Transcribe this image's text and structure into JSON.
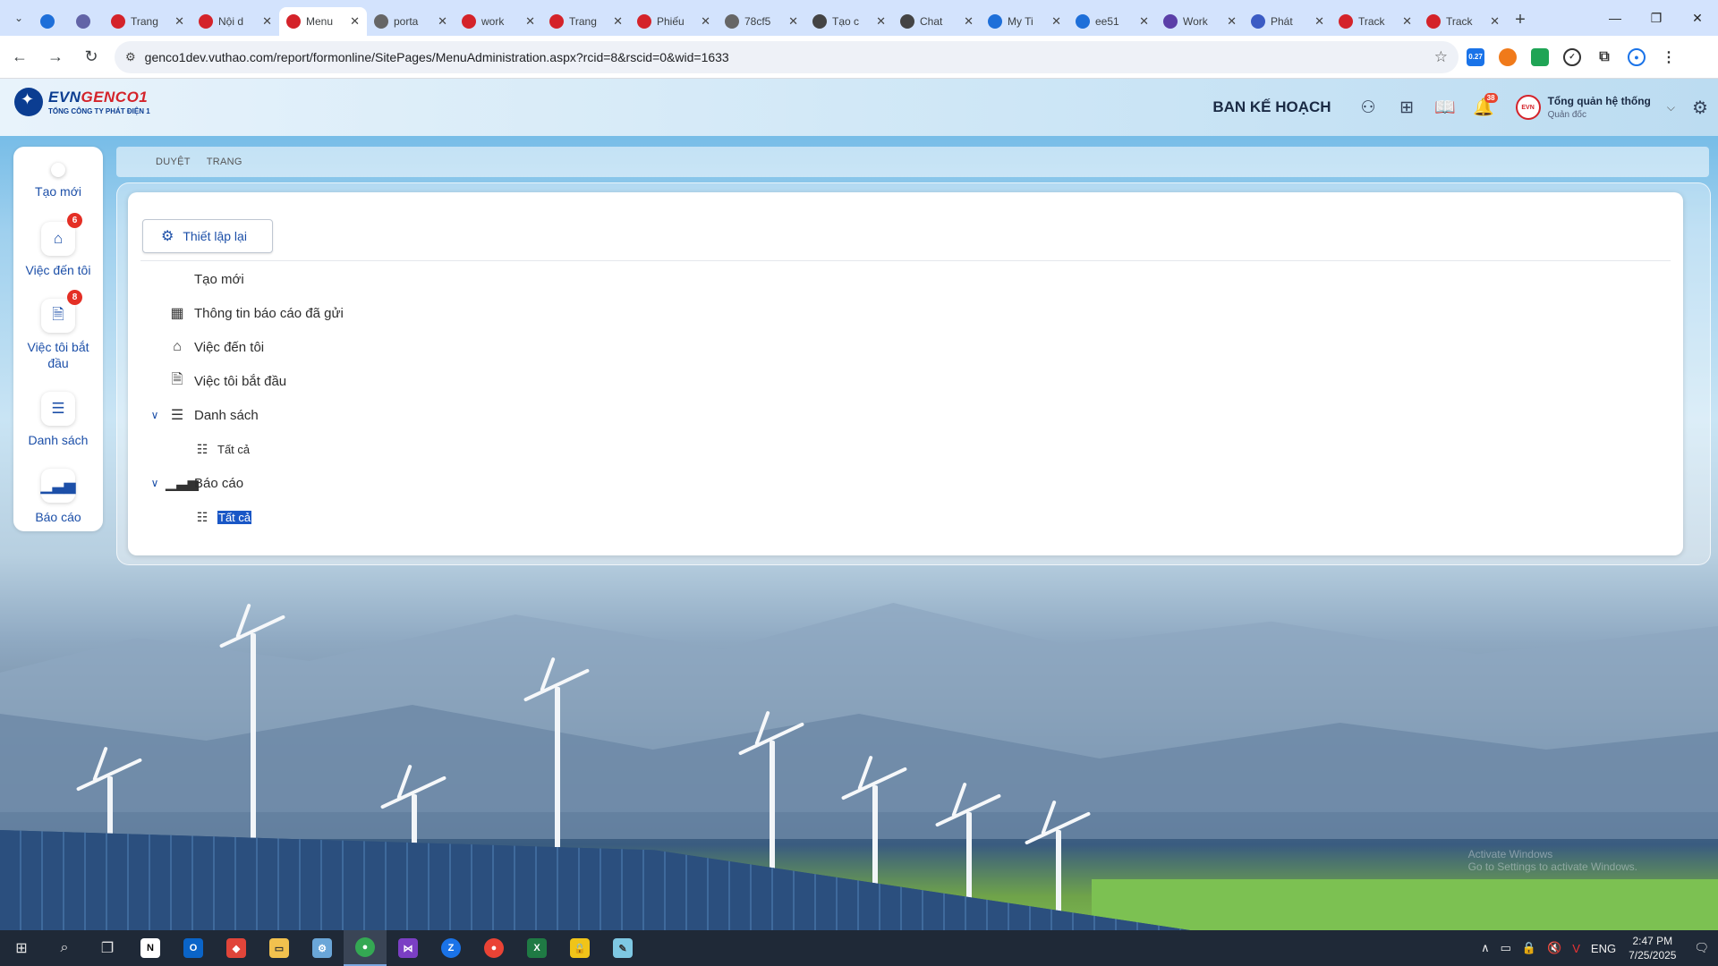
{
  "browser": {
    "tabs": [
      {
        "title": "",
        "color": "#1e6fd9",
        "pinned": true
      },
      {
        "title": "",
        "color": "#6264a7",
        "pinned": true
      },
      {
        "title": "Trang",
        "color": "#d4232a"
      },
      {
        "title": "Nội d",
        "color": "#d4232a"
      },
      {
        "title": "Menu",
        "color": "#d4232a",
        "active": true
      },
      {
        "title": "porta",
        "color": "#666666"
      },
      {
        "title": "work",
        "color": "#d4232a"
      },
      {
        "title": "Trang",
        "color": "#d4232a"
      },
      {
        "title": "Phiếu",
        "color": "#d4232a"
      },
      {
        "title": "78cf5",
        "color": "#666666"
      },
      {
        "title": "Tạo c",
        "color": "#444444"
      },
      {
        "title": "Chat",
        "color": "#444444"
      },
      {
        "title": "My Ti",
        "color": "#1e6fd9"
      },
      {
        "title": "ee51",
        "color": "#1e6fd9"
      },
      {
        "title": "Work",
        "color": "#5b3fa8"
      },
      {
        "title": "Phát",
        "color": "#3b5bc4"
      },
      {
        "title": "Track",
        "color": "#d4232a"
      },
      {
        "title": "Track",
        "color": "#d4232a"
      }
    ],
    "url": "genco1dev.vuthao.com/report/formonline/SitePages/MenuAdministration.aspx?rcid=8&rscid=0&wid=1633",
    "extension_badge": "0.27"
  },
  "header": {
    "logo_brand_a": "EVN",
    "logo_brand_b": "GENCO1",
    "logo_sub": "TỔNG CÔNG TY PHÁT ĐIỆN 1",
    "department": "BAN KẾ HOẠCH",
    "notification_count": "38",
    "user_name": "Tổng quản hệ thống",
    "user_role": "Quản đốc",
    "avatar_text": "EVN"
  },
  "sidebar": {
    "items": [
      {
        "label": "Tạo mới"
      },
      {
        "label": "Việc đến tôi",
        "badge": "6"
      },
      {
        "label": "Việc tôi bắt đầu",
        "badge": "8"
      },
      {
        "label": "Danh sách"
      },
      {
        "label": "Báo cáo"
      }
    ]
  },
  "breadcrumb": {
    "items": [
      "DUYỆT",
      "TRANG"
    ]
  },
  "panel": {
    "reset_label": "Thiết lập lại",
    "tree": [
      {
        "label": "Tạo mới",
        "icon": "none"
      },
      {
        "label": "Thông tin báo cáo đã gửi",
        "icon": "calendar-icon"
      },
      {
        "label": "Việc đến tôi",
        "icon": "inbox-icon"
      },
      {
        "label": "Việc tôi bắt đầu",
        "icon": "doc-search-icon"
      },
      {
        "label": "Danh sách",
        "icon": "list-icon",
        "expanded": true
      },
      {
        "label": "Tất cả",
        "icon": "checklist-icon"
      },
      {
        "label": "Báo cáo",
        "icon": "chart-icon",
        "expanded": true
      },
      {
        "label": "Tất cả",
        "icon": "checklist-icon",
        "selected": true
      }
    ]
  },
  "watermark": "Activate Windows\nGo to Settings to activate Windows.",
  "taskbar": {
    "language": "ENG",
    "time": "2:47 PM",
    "date": "7/25/2025"
  }
}
